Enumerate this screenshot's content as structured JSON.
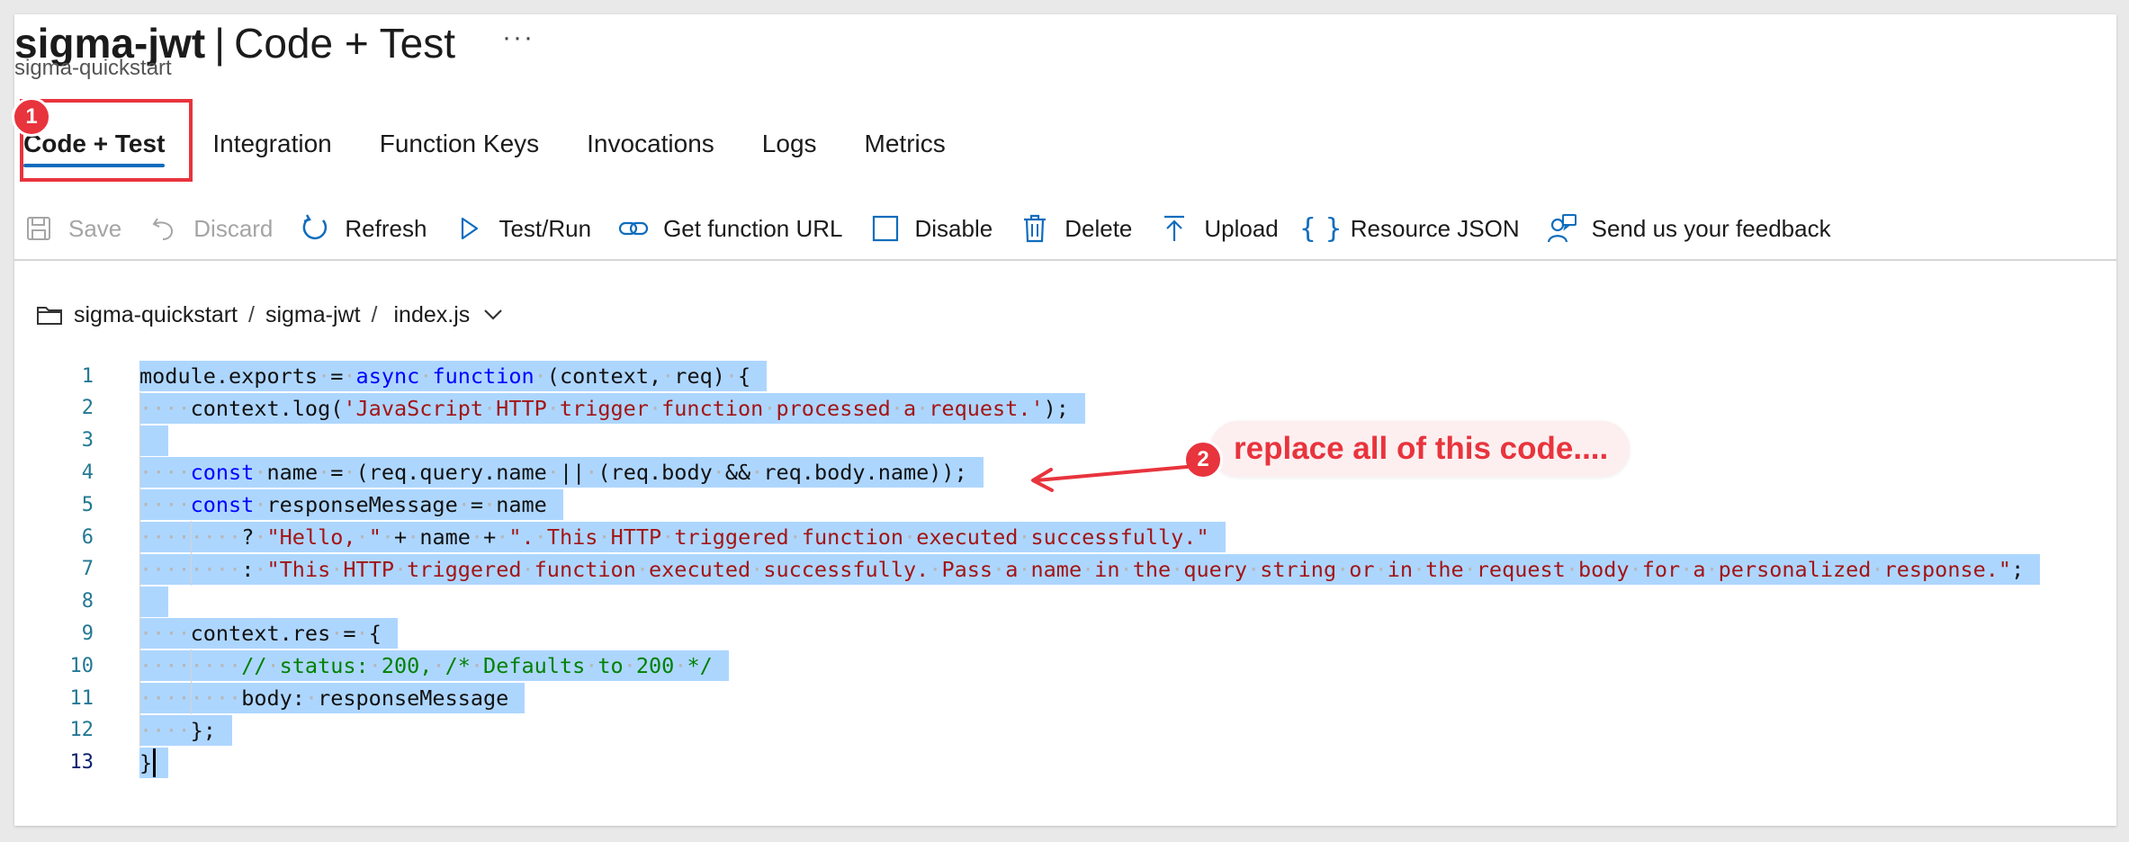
{
  "header": {
    "title_bold": "sigma-jwt",
    "title_sep": "|",
    "title_rest": "Code + Test",
    "more": "···",
    "subtitle": "sigma-quickstart"
  },
  "tabs": [
    {
      "label": "Code + Test",
      "active": true
    },
    {
      "label": "Integration"
    },
    {
      "label": "Function Keys"
    },
    {
      "label": "Invocations"
    },
    {
      "label": "Logs"
    },
    {
      "label": "Metrics"
    }
  ],
  "toolbar": {
    "save": "Save",
    "discard": "Discard",
    "refresh": "Refresh",
    "test_run": "Test/Run",
    "get_url": "Get function URL",
    "disable": "Disable",
    "delete": "Delete",
    "upload": "Upload",
    "resource_json": "Resource JSON",
    "feedback": "Send us your feedback"
  },
  "breadcrumb": {
    "app": "sigma-quickstart",
    "sep": "/",
    "function": "sigma-jwt",
    "file": "index.js"
  },
  "editor": {
    "lines": [
      "module.exports = async function (context, req) {",
      "    context.log('JavaScript HTTP trigger function processed a request.');",
      "",
      "    const name = (req.query.name || (req.body && req.body.name));",
      "    const responseMessage = name",
      "        ? \"Hello, \" + name + \". This HTTP triggered function executed successfully.\"",
      "        : \"This HTTP triggered function executed successfully. Pass a name in the query string or in the request body for a personalized response.\";",
      "",
      "    context.res = {",
      "        // status: 200, /* Defaults to 200 */",
      "        body: responseMessage",
      "    };",
      "}"
    ],
    "current_line": 13
  },
  "annotations": {
    "badge1": "1",
    "badge2": "2",
    "callout": "replace all of this code...."
  },
  "colors": {
    "accent": "#0f6cbd",
    "annotation_red": "#e8343d",
    "selection": "#add6ff",
    "line_number": "#237893",
    "keyword": "#0000ff",
    "string": "#a31515",
    "comment": "#008000"
  },
  "icons": {
    "save": "save-icon",
    "discard": "undo-icon",
    "refresh": "refresh-icon",
    "test_run": "play-icon",
    "get_url": "link-icon",
    "disable": "checkbox-icon",
    "delete": "trash-icon",
    "upload": "upload-icon",
    "resource_json": "braces-icon",
    "feedback": "feedback-person-icon",
    "folder": "folder-icon",
    "chevron": "chevron-down-icon"
  }
}
